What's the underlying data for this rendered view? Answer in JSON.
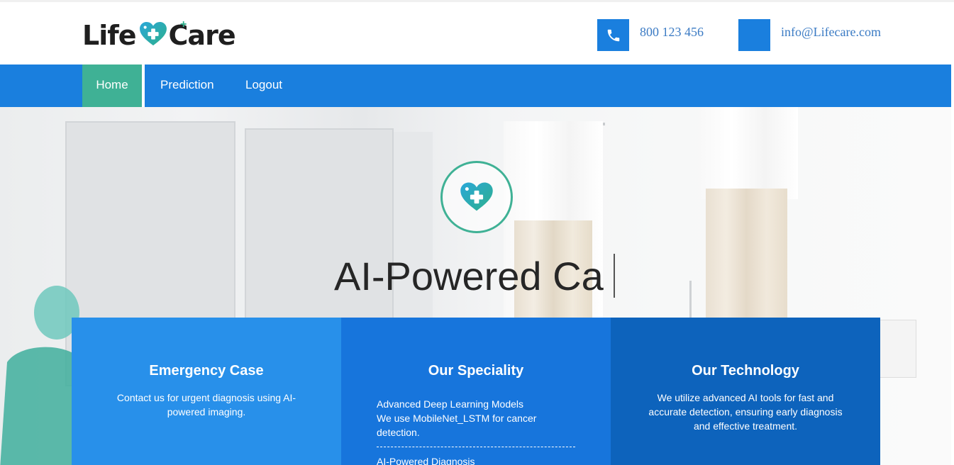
{
  "header": {
    "logo": {
      "word1": "Life",
      "word2": "Care"
    },
    "phone": "800 123 456",
    "email": "info@Lifecare.com"
  },
  "nav": {
    "items": [
      {
        "label": "Home",
        "active": true
      },
      {
        "label": "Prediction"
      },
      {
        "label": "Logout"
      }
    ]
  },
  "hero": {
    "title": "AI-Powered Ca"
  },
  "cards": [
    {
      "title": "Emergency Case",
      "body": "Contact us for urgent diagnosis using AI-powered imaging."
    },
    {
      "title": "Our Speciality",
      "items": [
        {
          "heading": "Advanced Deep Learning Models",
          "text": "We use MobileNet_LSTM for cancer detection."
        },
        {
          "heading": "AI-Powered Diagnosis",
          "text": ""
        }
      ]
    },
    {
      "title": "Our Technology",
      "body": "We utilize advanced AI tools for fast and accurate detection, ensuring early diagnosis and effective treatment."
    }
  ],
  "colors": {
    "primary": "#1a7fde",
    "accent": "#3fb195",
    "card1": "#2890ea",
    "card2": "#1775dc",
    "card3": "#0d63bc"
  },
  "icons": {
    "phone": "phone-icon",
    "email": "email-icon",
    "logo": "heart-cross-icon"
  }
}
